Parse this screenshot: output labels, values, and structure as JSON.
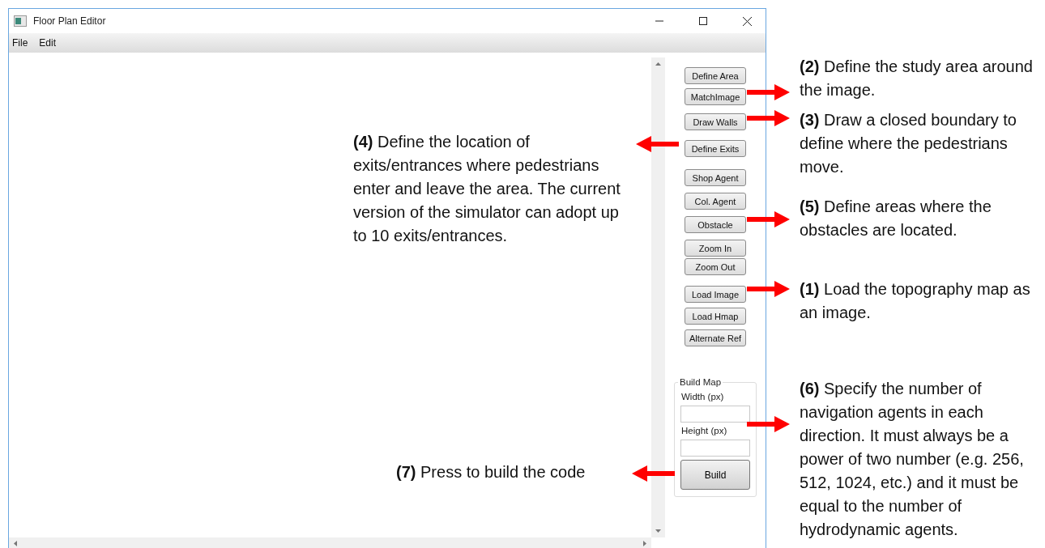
{
  "window": {
    "title": "Floor Plan Editor"
  },
  "menu": [
    {
      "label": "File"
    },
    {
      "label": "Edit"
    }
  ],
  "tool_buttons": [
    "Define Area",
    "MatchImage",
    "Draw Walls",
    "Define Exits",
    "Shop Agent",
    "Col. Agent",
    "Obstacle",
    "Zoom In",
    "Zoom Out",
    "Load Image",
    "Load Hmap",
    "Alternate Ref"
  ],
  "build_map": {
    "title": "Build Map",
    "fields": [
      {
        "label": "Width (px)"
      },
      {
        "label": "Height (px)"
      }
    ],
    "button": "Build"
  },
  "annotations": [
    {
      "text": "**(2)** Define the study area around the image.",
      "kind": "right-arrow"
    },
    {
      "text": "**(3)** Draw a closed boundary to define where the pedestrians move.",
      "kind": "right-arrow"
    },
    {
      "text": "**(4)** Define the location of exits/entrances where pedestrians enter and leave the area. The current version of the simulator can adopt up to 10 exits/entrances.",
      "kind": "left-arrow"
    },
    {
      "text": "**(5)** Define areas where the obstacles are located.",
      "kind": "right-arrow"
    },
    {
      "text": "**(1)** Load the topography map as an image.",
      "kind": "right-arrow"
    },
    {
      "text": "**(6)** Specify the number of navigation agents in each direction. It must always be a power of two number (e.g. 256, 512, 1024, etc.) and it must be equal to the number of hydrodynamic agents.",
      "kind": "right-arrow"
    },
    {
      "text": "**(7)** Press to build the code",
      "kind": "left-arrow"
    }
  ]
}
